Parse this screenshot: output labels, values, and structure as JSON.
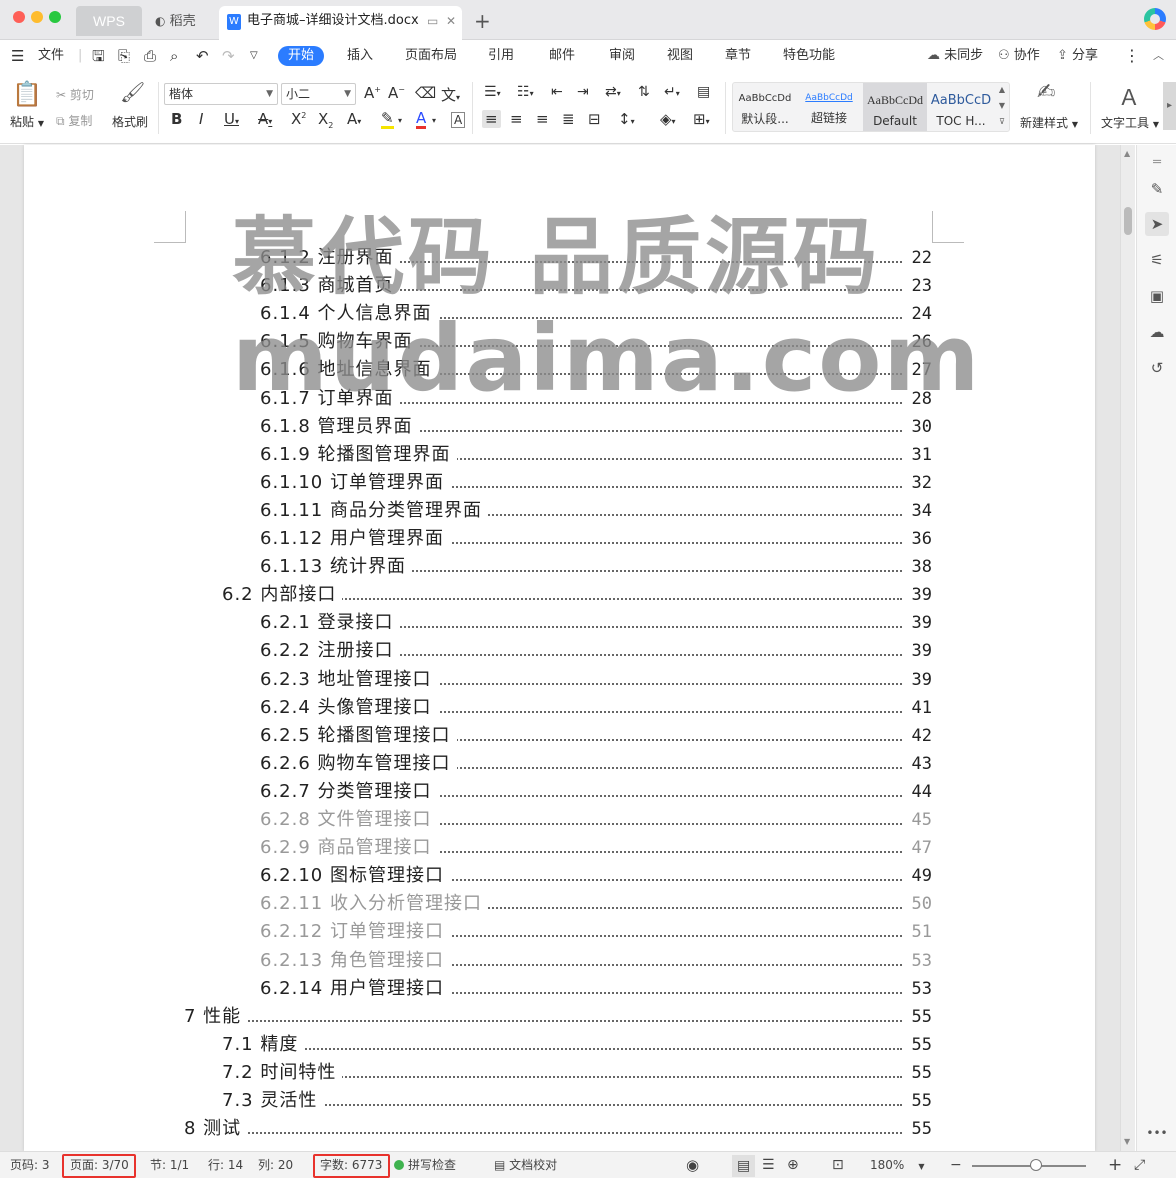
{
  "titlebar": {
    "tabs": [
      {
        "label": "WPS"
      },
      {
        "label": "稻壳"
      },
      {
        "label": "电子商城–详细设计文档.docx"
      }
    ],
    "new_tab_icon": "plus-icon",
    "close_icon": "close-icon"
  },
  "menu": {
    "file_label": "文件",
    "tabs": [
      "开始",
      "插入",
      "页面布局",
      "引用",
      "邮件",
      "审阅",
      "视图",
      "章节",
      "特色功能"
    ],
    "sync_label": "未同步",
    "collab_label": "协作",
    "share_label": "分享"
  },
  "ribbon": {
    "paste_label": "粘贴",
    "cut_label": "剪切",
    "copy_label": "复制",
    "format_painter_label": "格式刷",
    "font_name": "楷体",
    "font_size": "小二",
    "styles": [
      {
        "preview": "AaBbCcDd",
        "name": "默认段..."
      },
      {
        "preview": "AaBbCcDd",
        "name": "超链接"
      },
      {
        "preview": "AaBbCcDd",
        "name": "Default"
      },
      {
        "preview": "AaBbCcD",
        "name": "TOC H..."
      }
    ],
    "new_style_label": "新建样式",
    "text_tools_label": "文字工具"
  },
  "watermark": {
    "line1": "慕代码 品质源码",
    "line2": "mudaima.com"
  },
  "toc": [
    {
      "text": "6.1.2 注册界面",
      "page": "22",
      "level": 3,
      "faded": false
    },
    {
      "text": "6.1.3 商城首页",
      "page": "23",
      "level": 3,
      "faded": false
    },
    {
      "text": "6.1.4 个人信息界面",
      "page": "24",
      "level": 3,
      "faded": false
    },
    {
      "text": "6.1.5 购物车界面",
      "page": "26",
      "level": 3,
      "faded": false
    },
    {
      "text": "6.1.6 地址信息界面",
      "page": "27",
      "level": 3,
      "faded": false
    },
    {
      "text": "6.1.7 订单界面",
      "page": "28",
      "level": 3,
      "faded": false
    },
    {
      "text": "6.1.8 管理员界面",
      "page": "30",
      "level": 3,
      "faded": false
    },
    {
      "text": "6.1.9 轮播图管理界面",
      "page": "31",
      "level": 3,
      "faded": false
    },
    {
      "text": "6.1.10 订单管理界面",
      "page": "32",
      "level": 3,
      "faded": false
    },
    {
      "text": "6.1.11 商品分类管理界面",
      "page": "34",
      "level": 3,
      "faded": false
    },
    {
      "text": "6.1.12 用户管理界面",
      "page": "36",
      "level": 3,
      "faded": false
    },
    {
      "text": "6.1.13 统计界面",
      "page": "38",
      "level": 3,
      "faded": false
    },
    {
      "text": "6.2 内部接口",
      "page": "39",
      "level": 2,
      "faded": false
    },
    {
      "text": "6.2.1 登录接口",
      "page": "39",
      "level": 3,
      "faded": false
    },
    {
      "text": "6.2.2 注册接口",
      "page": "39",
      "level": 3,
      "faded": false
    },
    {
      "text": "6.2.3 地址管理接口",
      "page": "39",
      "level": 3,
      "faded": false
    },
    {
      "text": "6.2.4 头像管理接口",
      "page": "41",
      "level": 3,
      "faded": false
    },
    {
      "text": "6.2.5 轮播图管理接口",
      "page": "42",
      "level": 3,
      "faded": false
    },
    {
      "text": "6.2.6 购物车管理接口",
      "page": "43",
      "level": 3,
      "faded": false
    },
    {
      "text": "6.2.7 分类管理接口",
      "page": "44",
      "level": 3,
      "faded": false
    },
    {
      "text": "6.2.8 文件管理接口",
      "page": "45",
      "level": 3,
      "faded": true
    },
    {
      "text": "6.2.9 商品管理接口",
      "page": "47",
      "level": 3,
      "faded": true
    },
    {
      "text": "6.2.10 图标管理接口",
      "page": "49",
      "level": 3,
      "faded": false
    },
    {
      "text": "6.2.11 收入分析管理接口",
      "page": "50",
      "level": 3,
      "faded": true
    },
    {
      "text": "6.2.12 订单管理接口",
      "page": "51",
      "level": 3,
      "faded": true
    },
    {
      "text": "6.2.13 角色管理接口",
      "page": "53",
      "level": 3,
      "faded": true
    },
    {
      "text": "6.2.14 用户管理接口",
      "page": "53",
      "level": 3,
      "faded": false
    },
    {
      "text": "7 性能",
      "page": "55",
      "level": 1,
      "faded": false
    },
    {
      "text": "7.1 精度",
      "page": "55",
      "level": 2,
      "faded": false
    },
    {
      "text": "7.2 时间特性",
      "page": "55",
      "level": 2,
      "faded": false
    },
    {
      "text": "7.3 灵活性",
      "page": "55",
      "level": 2,
      "faded": false
    },
    {
      "text": "8 测试",
      "page": "55",
      "level": 1,
      "faded": false
    }
  ],
  "status": {
    "page_num": "页码: 3",
    "pages": "页面: 3/70",
    "section": "节: 1/1",
    "row": "行: 14",
    "col": "列: 20",
    "word_count": "字数: 6773",
    "spellcheck": "拼写检查",
    "proofread": "文档校对",
    "zoom": "180%",
    "zoom_fraction": 0.56
  },
  "colors": {
    "accent": "#2b7cff",
    "highlight_box": "#e8322c"
  }
}
